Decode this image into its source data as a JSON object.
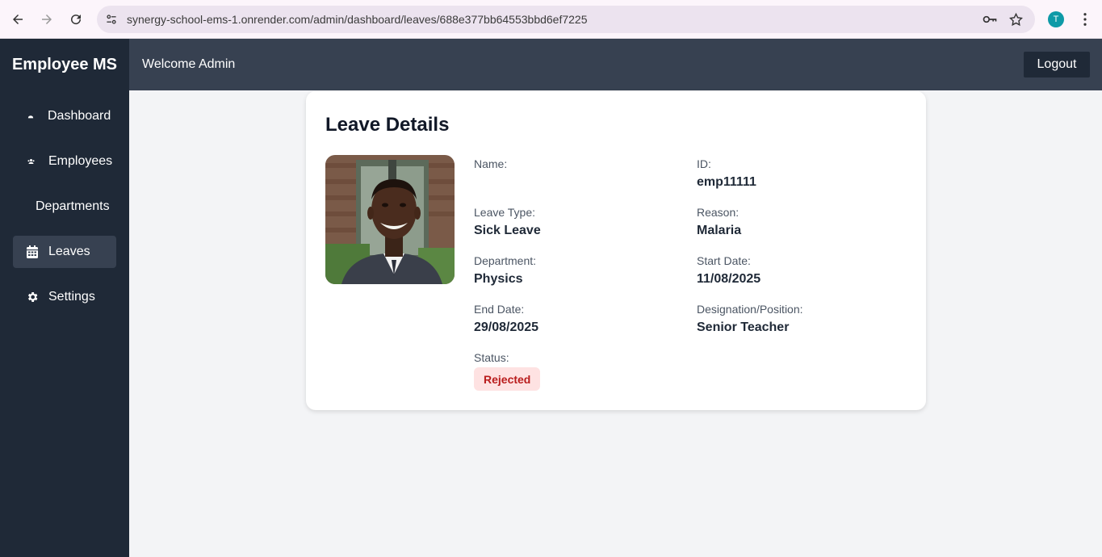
{
  "browser": {
    "url": "synergy-school-ems-1.onrender.com/admin/dashboard/leaves/688e377bb64553bbd6ef7225",
    "profile_initial": "T"
  },
  "app": {
    "brand": "Employee MS",
    "welcome": "Welcome Admin",
    "logout": "Logout"
  },
  "sidebar": {
    "items": [
      {
        "label": "Dashboard",
        "icon": "dashboard-icon"
      },
      {
        "label": "Employees",
        "icon": "users-icon"
      },
      {
        "label": "Departments",
        "icon": ""
      },
      {
        "label": "Leaves",
        "icon": "calendar-icon",
        "active": true
      },
      {
        "label": "Settings",
        "icon": "gear-icon"
      }
    ]
  },
  "leave": {
    "title": "Leave Details",
    "fields": {
      "name": {
        "label": "Name:",
        "value": ""
      },
      "id": {
        "label": "ID:",
        "value": "emp11111"
      },
      "leave_type": {
        "label": "Leave Type:",
        "value": "Sick Leave"
      },
      "reason": {
        "label": "Reason:",
        "value": "Malaria"
      },
      "department": {
        "label": "Department:",
        "value": "Physics"
      },
      "start_date": {
        "label": "Start Date:",
        "value": "11/08/2025"
      },
      "end_date": {
        "label": "End Date:",
        "value": "29/08/2025"
      },
      "designation": {
        "label": "Designation/Position:",
        "value": "Senior Teacher"
      },
      "status": {
        "label": "Status:",
        "value": "Rejected"
      }
    }
  },
  "colors": {
    "sidebar_bg": "#1f2937",
    "topbar_bg": "#374151",
    "status_rejected_bg": "#fee2e2",
    "status_rejected_text": "#b91c1c"
  }
}
